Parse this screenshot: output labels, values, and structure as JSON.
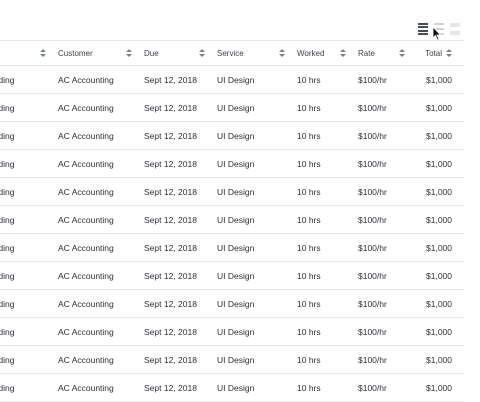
{
  "toolbar": {
    "density_icons": [
      "compact-density-icon",
      "default-density-icon",
      "comfortable-density-icon"
    ]
  },
  "table": {
    "columns": [
      "Status",
      "Customer",
      "Due",
      "Service",
      "Worked",
      "Rate",
      "Total"
    ],
    "visible_column_labels": [
      "tus",
      "Customer",
      "Due",
      "Service",
      "Worked",
      "Rate",
      "Total"
    ],
    "rows": [
      {
        "status": "tstanding",
        "customer": "AC Accounting",
        "due": "Sept 12, 2018",
        "service": "UI Design",
        "worked": "10 hrs",
        "rate": "$100/hr",
        "total": "$1,000"
      },
      {
        "status": "tstanding",
        "customer": "AC Accounting",
        "due": "Sept 12, 2018",
        "service": "UI Design",
        "worked": "10 hrs",
        "rate": "$100/hr",
        "total": "$1,000"
      },
      {
        "status": "tstanding",
        "customer": "AC Accounting",
        "due": "Sept 12, 2018",
        "service": "UI Design",
        "worked": "10 hrs",
        "rate": "$100/hr",
        "total": "$1,000"
      },
      {
        "status": "tstanding",
        "customer": "AC Accounting",
        "due": "Sept 12, 2018",
        "service": "UI Design",
        "worked": "10 hrs",
        "rate": "$100/hr",
        "total": "$1,000"
      },
      {
        "status": "tstanding",
        "customer": "AC Accounting",
        "due": "Sept 12, 2018",
        "service": "UI Design",
        "worked": "10 hrs",
        "rate": "$100/hr",
        "total": "$1,000"
      },
      {
        "status": "tstanding",
        "customer": "AC Accounting",
        "due": "Sept 12, 2018",
        "service": "UI Design",
        "worked": "10 hrs",
        "rate": "$100/hr",
        "total": "$1,000"
      },
      {
        "status": "tstanding",
        "customer": "AC Accounting",
        "due": "Sept 12, 2018",
        "service": "UI Design",
        "worked": "10 hrs",
        "rate": "$100/hr",
        "total": "$1,000"
      },
      {
        "status": "tstanding",
        "customer": "AC Accounting",
        "due": "Sept 12, 2018",
        "service": "UI Design",
        "worked": "10 hrs",
        "rate": "$100/hr",
        "total": "$1,000"
      },
      {
        "status": "tstanding",
        "customer": "AC Accounting",
        "due": "Sept 12, 2018",
        "service": "UI Design",
        "worked": "10 hrs",
        "rate": "$100/hr",
        "total": "$1,000"
      },
      {
        "status": "tstanding",
        "customer": "AC Accounting",
        "due": "Sept 12, 2018",
        "service": "UI Design",
        "worked": "10 hrs",
        "rate": "$100/hr",
        "total": "$1,000"
      },
      {
        "status": "tstanding",
        "customer": "AC Accounting",
        "due": "Sept 12, 2018",
        "service": "UI Design",
        "worked": "10 hrs",
        "rate": "$100/hr",
        "total": "$1,000"
      },
      {
        "status": "tstanding",
        "customer": "AC Accounting",
        "due": "Sept 12, 2018",
        "service": "UI Design",
        "worked": "10 hrs",
        "rate": "$100/hr",
        "total": "$1,000"
      }
    ]
  },
  "colors": {
    "border": "#e6e8eb",
    "text": "#2b2f36",
    "icon_active": "#4a4f57",
    "icon_inactive": "#cfd3d8"
  }
}
